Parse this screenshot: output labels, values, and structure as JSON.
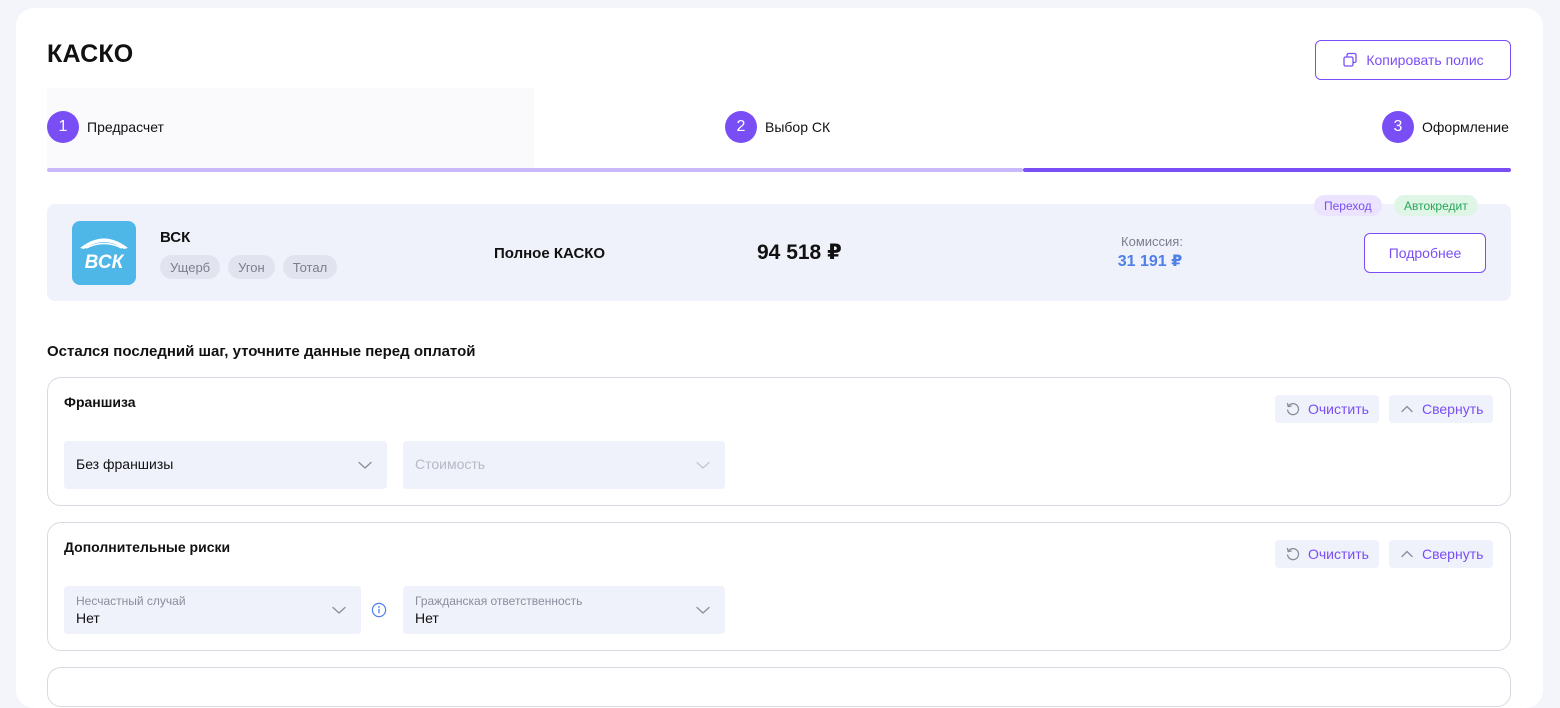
{
  "page": {
    "title": "КАСКО",
    "copy_button": "Копировать полис"
  },
  "stepper": {
    "steps": [
      {
        "num": "1",
        "label": "Предрасчет"
      },
      {
        "num": "2",
        "label": "Выбор СК"
      },
      {
        "num": "3",
        "label": "Оформление"
      }
    ],
    "active_step": 3
  },
  "offer": {
    "company": "ВСК",
    "logo_text": "ВСК",
    "chips": [
      "Ущерб",
      "Угон",
      "Тотал"
    ],
    "product": "Полное КАСКО",
    "price": "94 518 ₽",
    "commission_label": "Комиссия:",
    "commission_value": "31 191 ₽",
    "badges": [
      "Переход",
      "Автокредит"
    ],
    "details_button": "Подробнее"
  },
  "subtitle": "Остался последний шаг, уточните данные перед оплатой",
  "sections": [
    {
      "title": "Франшиза",
      "clear_button": "Очистить",
      "collapse_button": "Свернуть",
      "fields": [
        {
          "value": "Без франшизы"
        },
        {
          "placeholder": "Стоимость"
        }
      ]
    },
    {
      "title": "Дополнительные риски",
      "clear_button": "Очистить",
      "collapse_button": "Свернуть",
      "fields": [
        {
          "label": "Несчастный случай",
          "value": "Нет"
        },
        {
          "label": "Гражданская ответственность",
          "value": "Нет"
        }
      ]
    }
  ],
  "colors": {
    "accent": "#7a4ef5",
    "commission": "#4f7fe9",
    "logo_bg": "#4fb6e8",
    "badge_green": "#27a55a"
  }
}
